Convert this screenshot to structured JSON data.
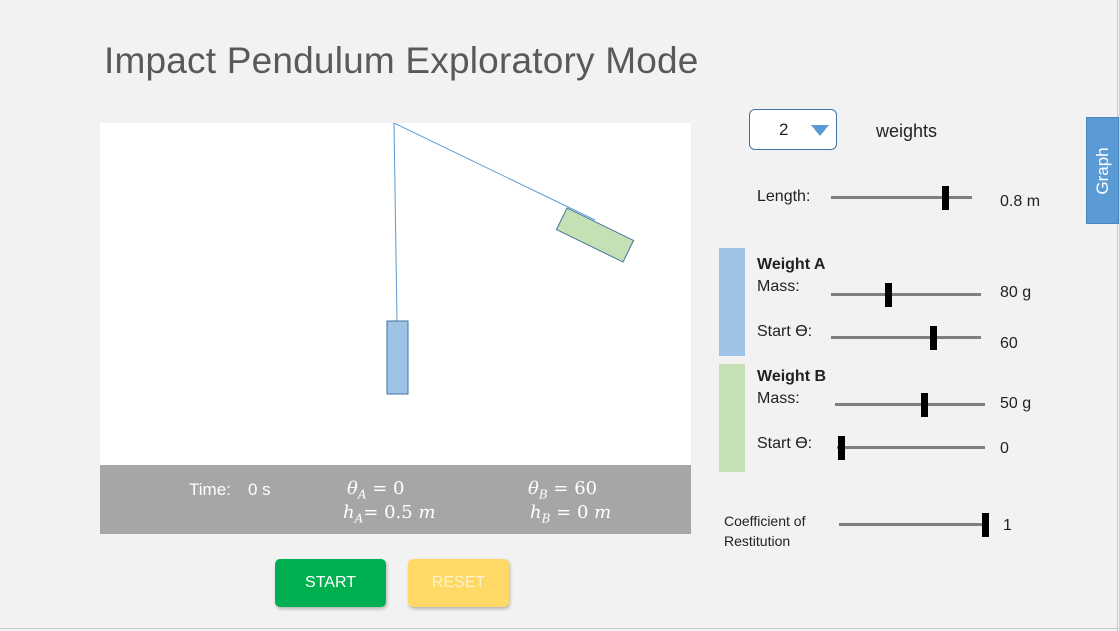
{
  "page": {
    "title": "Impact Pendulum Exploratory Mode"
  },
  "controls": {
    "weights_select": {
      "value": "2",
      "label": "weights"
    },
    "length": {
      "label": "Length:",
      "value": "0.8 m",
      "fraction": 0.81
    },
    "weight_a": {
      "heading": "Weight A",
      "mass": {
        "label": "Mass:",
        "value": "80 g",
        "fraction": 0.38
      },
      "start_theta": {
        "label": "Start ϴ:",
        "value": "60",
        "fraction": 0.68
      },
      "color": "#9dc3e6"
    },
    "weight_b": {
      "heading": "Weight B",
      "mass": {
        "label": "Mass:",
        "value": "50 g",
        "fraction": 0.59
      },
      "start_theta": {
        "label": "Start ϴ:",
        "value": "0",
        "fraction": 0.03
      },
      "color": "#c5e0b4"
    },
    "restitution": {
      "label_line1": "Coefficient of",
      "label_line2": "Restitution",
      "value": "1",
      "fraction": 0.97
    }
  },
  "info_bar": {
    "time_label": "Time:",
    "time_value": "0 s",
    "theta_a": {
      "symbol": "θ",
      "sub": "A",
      "eq": "= 0"
    },
    "h_a": {
      "symbol": "h",
      "sub": "A",
      "eq": "= 0.5",
      "unit": "m"
    },
    "theta_b": {
      "symbol": "θ",
      "sub": "B",
      "eq": "= 60"
    },
    "h_b": {
      "symbol": "h",
      "sub": "B",
      "eq": "= 0",
      "unit": "m"
    }
  },
  "buttons": {
    "start": "START",
    "reset": "RESET"
  },
  "side_tab": {
    "label": "Graph"
  },
  "colors": {
    "start_button": "#00b050",
    "reset_button": "#ffd966",
    "accent": "#5b9bd5",
    "info_bar": "#a6a6a6",
    "pendulum_string": "#5b9bd5"
  }
}
